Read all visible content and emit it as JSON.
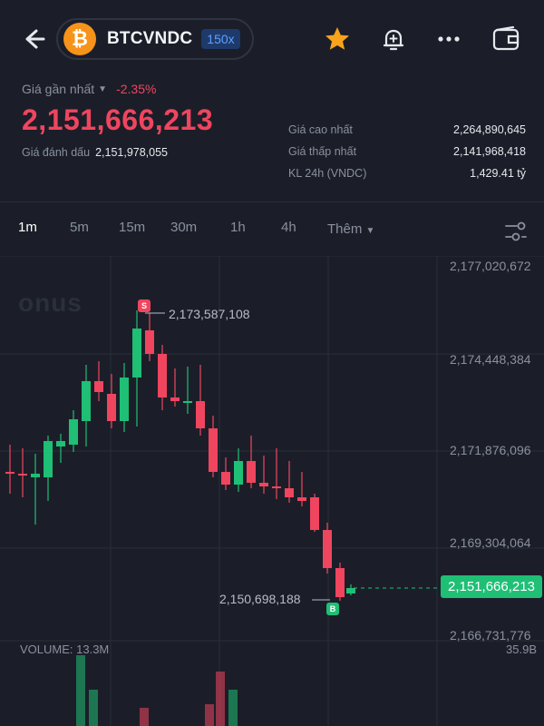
{
  "header": {
    "pair": "BTCVNDC",
    "leverage": "150x",
    "coin_symbol": "₿"
  },
  "price": {
    "label": "Giá gần nhất",
    "change_pct": "-2.35%",
    "last": "2,151,666,213",
    "mark_label": "Giá đánh dấu",
    "mark_value": "2,151,978,055"
  },
  "stats": [
    {
      "label": "Giá cao nhất",
      "value": "2,264,890,645"
    },
    {
      "label": "Giá thấp nhất",
      "value": "2,141,968,418"
    },
    {
      "label": "KL 24h (VNDC)",
      "value": "1,429.41 tỷ"
    }
  ],
  "timeframes": [
    "1m",
    "5m",
    "15m",
    "30m",
    "1h",
    "4h"
  ],
  "active_timeframe": "1m",
  "more_label": "Thêm",
  "chart": {
    "watermark": "onus",
    "y_axis_labels": [
      "2,177,020,672",
      "2,174,448,384",
      "2,171,876,096",
      "2,169,304,064",
      "2,166,731,776"
    ],
    "high_marker": "2,173,587,108",
    "low_marker": "2,150,698,188",
    "current_price": "2,151,666,213",
    "sell_badge": "S",
    "buy_badge": "B",
    "volume_label": "VOLUME: 13.3M",
    "volume_axis": "35.9B",
    "colors": {
      "up": "#1fbf75",
      "down": "#f0455f",
      "background": "#1b1e28"
    }
  }
}
